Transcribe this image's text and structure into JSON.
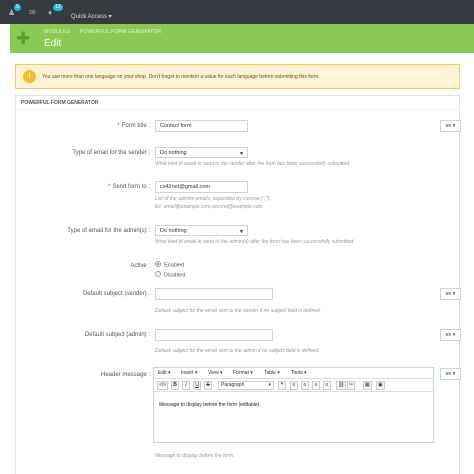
{
  "topbar": {
    "badges": [
      "5",
      "13"
    ],
    "quick_access": "Quick Access ▾"
  },
  "header": {
    "breadcrumb": [
      "MODULES",
      "POWERFUL FORM GENERATOR"
    ],
    "title": "Edit"
  },
  "alert": {
    "icon": "!",
    "text": "You use more than one language on your shop. Don't forget to mention a value for each language before submitting this form."
  },
  "panel": {
    "title": "POWERFUL FORM GENERATOR"
  },
  "form": {
    "form_title": {
      "label": "Form title :",
      "value": "Contact form",
      "lang": "en ▾"
    },
    "type_sender": {
      "label": "Type of email for the sender :",
      "value": "Do nothing",
      "help": "What kind of email to send to the sender after the form has been successfully submitted."
    },
    "send_form_to": {
      "label": "Send form to :",
      "value": "cx42net@gmail.com",
      "help_line1": "List of the admins emails, separated by comma (\",\").",
      "help_line2": "Ex: email@example.com,second@example.com"
    },
    "type_admin": {
      "label": "Type of email for the admin(s) :",
      "value": "Do nothing",
      "help": "What kind of email to send to the admin(s) after the form has been successfully submitted."
    },
    "active": {
      "label": "Active :",
      "enabled": "Enabled",
      "disabled": "Disabled"
    },
    "subject_sender": {
      "label": "Default subject (sender) :",
      "value": "",
      "lang": "en ▾",
      "help": "Default subject for the email sent to the sender if no subject field is defined."
    },
    "subject_admin": {
      "label": "Default subject (admin) :",
      "value": "",
      "lang": "en ▾",
      "help": "Default subject for the email sent to the admin if no subject field is defined."
    },
    "header_message": {
      "label": "Header message :",
      "lang": "en ▾",
      "help": "Message to display before the form.",
      "content": "Message to display before the form (editable)."
    }
  },
  "editor": {
    "menus": [
      "Edit ▾",
      "Insert ▾",
      "View ▾",
      "Format ▾",
      "Table ▾",
      "Tools ▾"
    ],
    "tools_left": [
      "</>",
      "B",
      "I",
      "U",
      "S"
    ],
    "paragraph": "Paragraph",
    "tools_right": [
      "❝",
      "≡",
      "≡",
      "≡",
      "≡",
      "⛓",
      "✂",
      "▦",
      "▣"
    ]
  }
}
